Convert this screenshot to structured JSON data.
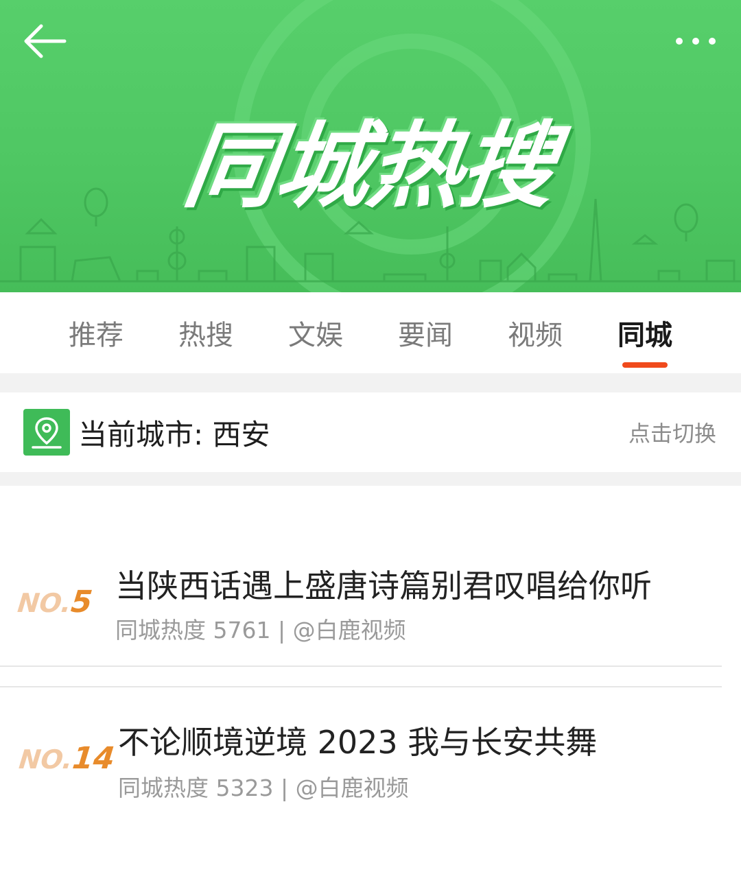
{
  "banner": {
    "title": "同城热搜",
    "back_icon": "back-arrow-icon",
    "more_icon": "more-dots-icon",
    "color": "#52cb66"
  },
  "tabs": [
    {
      "label": "推荐",
      "active": false
    },
    {
      "label": "热搜",
      "active": false
    },
    {
      "label": "文娱",
      "active": false
    },
    {
      "label": "要闻",
      "active": false
    },
    {
      "label": "视频",
      "active": false
    },
    {
      "label": "同城",
      "active": true
    }
  ],
  "accent_color": "#f04a1c",
  "city": {
    "icon": "location-pin-icon",
    "label": "当前城市: 西安",
    "switch_label": "点击切换"
  },
  "news": [
    {
      "rank_prefix": "NO.",
      "rank": "5",
      "title": "当陕西话遇上盛唐诗篇别君叹唱给你听",
      "meta": "同城热度 5761 | @白鹿视频"
    },
    {
      "rank_prefix": "NO.",
      "rank": "14",
      "title": "不论顺境逆境 2023 我与长安共舞",
      "meta": "同城热度 5323 | @白鹿视频"
    }
  ]
}
